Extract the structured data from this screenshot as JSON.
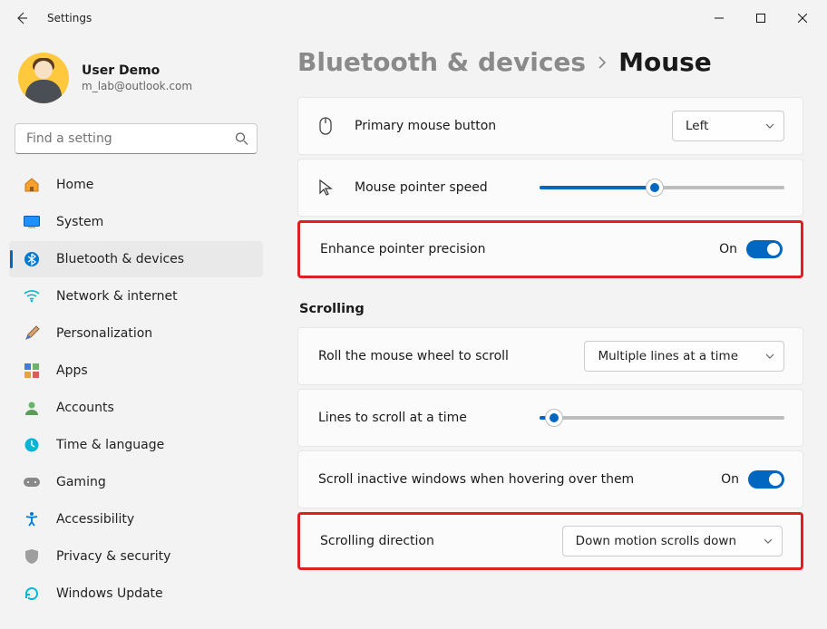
{
  "window": {
    "title": "Settings"
  },
  "user": {
    "name": "User Demo",
    "email": "m_lab@outlook.com"
  },
  "search": {
    "placeholder": "Find a setting"
  },
  "nav": {
    "items": [
      {
        "label": "Home"
      },
      {
        "label": "System"
      },
      {
        "label": "Bluetooth & devices"
      },
      {
        "label": "Network & internet"
      },
      {
        "label": "Personalization"
      },
      {
        "label": "Apps"
      },
      {
        "label": "Accounts"
      },
      {
        "label": "Time & language"
      },
      {
        "label": "Gaming"
      },
      {
        "label": "Accessibility"
      },
      {
        "label": "Privacy & security"
      },
      {
        "label": "Windows Update"
      }
    ],
    "selected_index": 2
  },
  "breadcrumb": {
    "parent": "Bluetooth & devices",
    "current": "Mouse"
  },
  "settings": {
    "primary_button": {
      "label": "Primary mouse button",
      "value": "Left"
    },
    "pointer_speed": {
      "label": "Mouse pointer speed",
      "percent": 47
    },
    "enhance_precision": {
      "label": "Enhance pointer precision",
      "state_text": "On",
      "on": true
    },
    "scrolling_section": "Scrolling",
    "wheel_scroll": {
      "label": "Roll the mouse wheel to scroll",
      "value": "Multiple lines at a time"
    },
    "lines_scroll": {
      "label": "Lines to scroll at a time",
      "percent": 6
    },
    "inactive_hover": {
      "label": "Scroll inactive windows when hovering over them",
      "state_text": "On",
      "on": true
    },
    "scroll_direction": {
      "label": "Scrolling direction",
      "value": "Down motion scrolls down"
    }
  }
}
